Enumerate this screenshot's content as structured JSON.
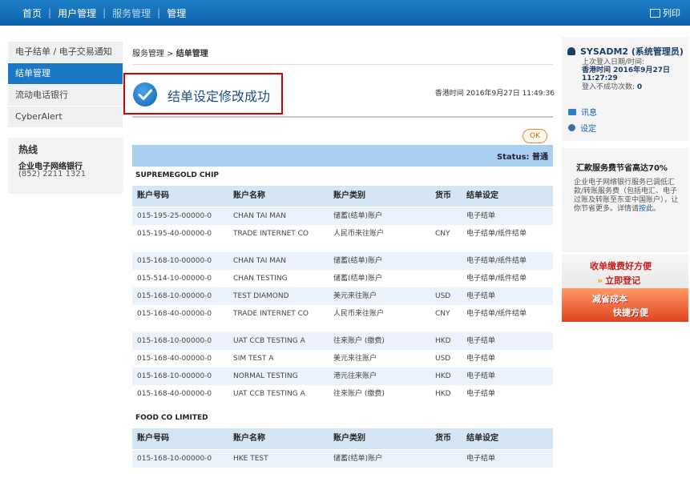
{
  "topnav": {
    "items": [
      "首页",
      "用户管理",
      "服务管理",
      "管理"
    ],
    "separators": [
      "|",
      "|",
      "|"
    ],
    "print_label": "列印"
  },
  "sidebar": {
    "items": [
      {
        "label": "电子结单 / 电子交易通知",
        "active": false
      },
      {
        "label": "结单管理",
        "active": true
      },
      {
        "label": "流动电话银行",
        "active": false
      },
      {
        "label": "CyberAlert",
        "active": false
      }
    ],
    "hotline": {
      "title": "热线",
      "name": "企业电子网络银行",
      "phone": "(852) 2211 1321"
    }
  },
  "breadcrumb": {
    "parent": "服务管理 > ",
    "current": "结单管理"
  },
  "success": {
    "message": "结单设定修改成功"
  },
  "timestamp": "香港时间 2016年9月27日 11:49:36",
  "ok_button": "OK",
  "status": {
    "label": "Status: 普通"
  },
  "table_headers": [
    "账户号码",
    "账户名称",
    "账户类别",
    "货币",
    "结单设定"
  ],
  "companies": [
    {
      "name": "SUPREMEGOLD CHIP",
      "groups": [
        [
          [
            "015-195-25-00000-0",
            "CHAN TAI MAN",
            "储蓄(结单)账户",
            "",
            "电子结单"
          ],
          [
            "015-195-40-00000-0",
            "TRADE INTERNET CO",
            "人民币来往账户",
            "CNY",
            "电子结单/纸件结单"
          ]
        ],
        [
          [
            "015-168-10-00000-0",
            "CHAN TAI MAN",
            "储蓄(结单)账户",
            "",
            "电子结单/纸件结单"
          ],
          [
            "015-514-10-00000-0",
            "CHAN TESTING",
            "储蓄(结单)账户",
            "",
            "电子结单/纸件结单"
          ],
          [
            "015-168-10-00000-0",
            "TEST DIAMOND",
            "美元来往账户",
            "USD",
            "电子结单"
          ],
          [
            "015-168-40-00000-0",
            "TRADE INTERNET CO",
            "人民币来往账户",
            "CNY",
            "电子结单/纸件结单"
          ]
        ],
        [
          [
            "015-168-10-00000-0",
            "UAT CCB TESTING A",
            "往来账户 (缴费)",
            "HKD",
            "电子结单"
          ],
          [
            "015-168-40-00000-0",
            "SIM TEST A",
            "美元来往账户",
            "USD",
            "电子结单"
          ],
          [
            "015-168-10-00000-0",
            "NORMAL TESTING",
            "港元往来账户",
            "HKD",
            "电子结单"
          ],
          [
            "015-168-40-00000-0",
            "UAT CCB TESTING A",
            "往来账户 (缴费)",
            "HKD",
            "电子结单"
          ]
        ]
      ]
    },
    {
      "name": "FOOD CO LIMITED",
      "groups": [
        [
          [
            "015-168-10-00000-0",
            "HKE TEST",
            "储蓄(结单)账户",
            "",
            "电子结单"
          ]
        ]
      ]
    }
  ],
  "user_panel": {
    "user": "SYSADM2 (系统管理员)",
    "last_login_label": "上次登入日期/时间:",
    "last_login_value": "香港时间 2016年9月27日",
    "last_login_time": "11:27:29",
    "failed_label": "登入不成功次数: ",
    "failed_value": "0",
    "links": [
      "讯息",
      "设定"
    ]
  },
  "promo": {
    "title": "汇款服务费节省高达70%",
    "body": "企业电子网络银行服务已调低汇款/转账服务费（包括电汇、电子过账及转账至东亚中国账户），让你节省更多。详情请",
    "link": "按此",
    "body_end": "。"
  },
  "ad": {
    "line1": "收单缴费好方便",
    "line2": "立即登记",
    "arrow": "»",
    "line3": "减省成本",
    "line4": "快捷方便"
  }
}
